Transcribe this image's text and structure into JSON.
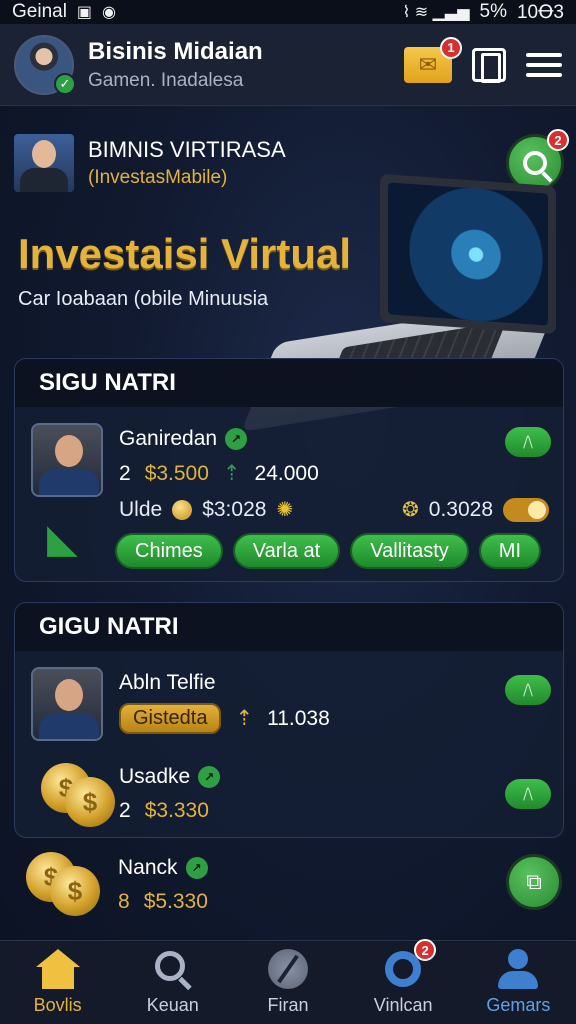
{
  "status_bar": {
    "carrier": "Geinal",
    "battery": "5%",
    "time": "10Ꝋ3"
  },
  "header": {
    "title": "Bisinis Midaian",
    "subtitle": "Gamen. Inadalesa",
    "mail_badge": "1"
  },
  "hero": {
    "profile_name": "BIMNIS VIRTIRASA",
    "profile_tag": "(InvestasMabile)",
    "search_badge": "2",
    "title": "Investaisi Virtual",
    "subtitle": "Car Ioabaan (obile Minuusia"
  },
  "panel1": {
    "heading": "SIGU NATRI",
    "item": {
      "name": "Ganiredan",
      "count": "2",
      "price": "$3.500",
      "trend": "24.000",
      "stat_label": "Ulde",
      "stat_value": "$3:028",
      "stat_right": "0.3028"
    },
    "actions": [
      "Chimes",
      "Varla at",
      "Vallitasty",
      "MI"
    ]
  },
  "panel2": {
    "heading": "GIGU NATRI",
    "items": [
      {
        "name": "Abln Telfie",
        "pill": "Gistedta",
        "trend": "11.038"
      },
      {
        "name": "Usadke",
        "count": "2",
        "price": "$3.330"
      },
      {
        "name": "Nanck",
        "count": "8",
        "price": "$5.330"
      }
    ]
  },
  "nav": {
    "items": [
      {
        "label": "Bovlis"
      },
      {
        "label": "Keuan"
      },
      {
        "label": "Firan"
      },
      {
        "label": "Vinlcan",
        "badge": "2"
      },
      {
        "label": "Gemars"
      }
    ]
  },
  "colors": {
    "accent_gold": "#e5b33a",
    "accent_green": "#2ea043",
    "background": "#111a30"
  }
}
